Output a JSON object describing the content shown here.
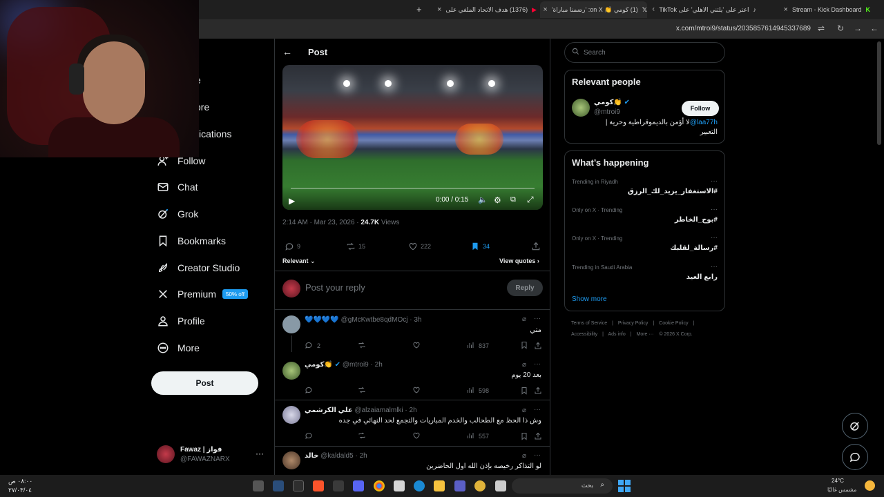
{
  "browser": {
    "tabs": [
      {
        "label": "Stream - Kick Dashboard"
      },
      {
        "label": "اعتر على 'يلتني الاهلي' على TikTok"
      },
      {
        "label": "(1) كومي 👏 on X: 'رضمنا مباراة'"
      },
      {
        "label": "(1376) هدف الاتحاد الملغي على"
      }
    ],
    "url": "x.com/mtroi9/status/2035857614945337689"
  },
  "nav": {
    "items": [
      {
        "label": "e"
      },
      {
        "label": "ore"
      },
      {
        "label": "ications"
      },
      {
        "label": "Follow"
      },
      {
        "label": "Chat"
      },
      {
        "label": "Grok"
      },
      {
        "label": "Bookmarks"
      },
      {
        "label": "Creator Studio"
      },
      {
        "label": "Premium"
      },
      {
        "label": "Profile"
      },
      {
        "label": "More"
      }
    ],
    "premium_badge": "50% off",
    "post_button": "Post",
    "account": {
      "name": "Fawaz | فواز",
      "handle": "@FAWAZNARX"
    }
  },
  "main": {
    "header_title": "Post",
    "video": {
      "time": "0:00 / 0:15"
    },
    "meta": {
      "time": "2:14 AM · Mar 23, 2026 · ",
      "views": "24.7K",
      "views_label": " Views"
    },
    "actions": {
      "replies": "9",
      "reposts": "15",
      "likes": "222",
      "bookmarks": "34"
    },
    "relevant_label": "Relevant",
    "view_quotes": "View quotes",
    "reply_placeholder": "Post your reply",
    "reply_button": "Reply",
    "replies": [
      {
        "name": "💙💙💙💙",
        "handle": "@gMcKwtbe8qdMOcj · 3h",
        "text": "متي",
        "replies": "2",
        "views": "837"
      },
      {
        "name": "كومي👏",
        "handle": "@mtroi9 · 2h",
        "text": "بعد 20 يوم",
        "replies": "",
        "views": "598"
      },
      {
        "name": "علي الكرشمي",
        "handle": "@alzaiamalmlki · 2h",
        "text": "وش ذا الحظ مع الطحالب والخدم المباريات والتجمع لحد النهائي في جده",
        "replies": "",
        "views": "557"
      },
      {
        "name": "خالد",
        "handle": "@kaldald5 · 2h",
        "text": "لو التذاكر رخيصه بإذن الله اول الحاضرين",
        "replies": "",
        "views": ""
      }
    ]
  },
  "right": {
    "search_placeholder": "Search",
    "relevant": {
      "title": "Relevant people",
      "name": "كومي👏",
      "handle": "@mtroi9",
      "follow": "Follow",
      "bio_mention": "@laa77h",
      "bio_line1": " | لا أؤمن بالديموقراطية وحرية",
      "bio_line2": "التعبير"
    },
    "happening": {
      "title": "What’s happening",
      "trends": [
        {
          "context": "Trending in Riyadh",
          "name": "#الاستغفار_يزيد_لك_الرزق"
        },
        {
          "context": "Only on X · Trending",
          "name": "#بوح_الخاطر"
        },
        {
          "context": "Only on X · Trending",
          "name": "#رسالة_لقلبك"
        },
        {
          "context": "Trending in Saudi Arabia",
          "name": "رابع العيد"
        }
      ],
      "show_more": "Show more",
      "more_dots": "···"
    },
    "footer": {
      "terms": "Terms of Service",
      "privacy": "Privacy Policy",
      "cookie": "Cookie Policy",
      "accessibility": "Accessibility",
      "ads": "Ads info",
      "more": "More ···",
      "copyright": "© 2026 X Corp.",
      "sep": "|"
    }
  },
  "taskbar": {
    "time": "٠٨:٠٠ ص",
    "date": "٢٧/٠٣/٠٤",
    "search": "بحث",
    "weather_temp": "24°C",
    "weather_text": "مشمس غالبًا"
  }
}
